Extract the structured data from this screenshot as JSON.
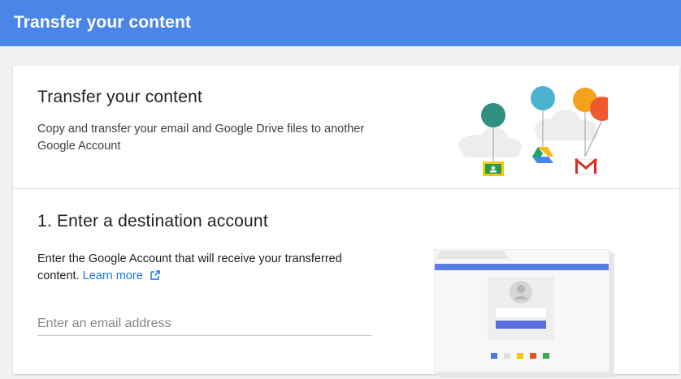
{
  "header": {
    "title": "Transfer your content"
  },
  "intro": {
    "title": "Transfer your content",
    "description": "Copy and transfer your email and Google Drive files to another Google Account"
  },
  "step1": {
    "title": "1. Enter a destination account",
    "description": "Enter the Google Account that will receive your transferred content.",
    "learn_more": "Learn more",
    "email_placeholder": "Enter an email address",
    "email_value": ""
  },
  "colors": {
    "header_bg": "#4a86e8",
    "link": "#1a73e8",
    "balloon_teal": "#2f8f80",
    "balloon_blue": "#4bb3cf",
    "balloon_orange": "#f4a21a",
    "balloon_red": "#ee5a2e"
  },
  "icons": {
    "intro_illustration": [
      "classroom-icon",
      "drive-icon",
      "gmail-icon"
    ],
    "link_icon": "external-link-icon"
  }
}
